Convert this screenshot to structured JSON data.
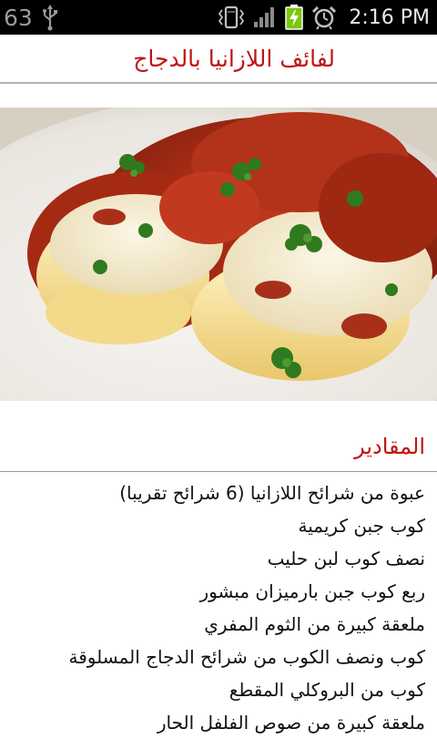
{
  "status_bar": {
    "battery_number": "63",
    "time": "2:16 PM",
    "icons": [
      "usb-icon",
      "vibrate-icon",
      "signal-icon",
      "battery-charging-icon",
      "alarm-icon"
    ]
  },
  "recipe": {
    "title": "لفائف اللازانيا بالدجاج",
    "image_description_icon": "recipe-photo",
    "section_heading": "المقادير",
    "ingredients": [
      "عبوة من شرائح اللازانيا (6 شرائح تقريبا)",
      "كوب جبن كريمية",
      "نصف كوب لبن حليب",
      "ربع كوب جبن بارميزان مبشور",
      "ملعقة كبيرة من الثوم المفري",
      "كوب ونصف الكوب من شرائح الدجاج المسلوقة",
      "كوب من البروكلي المقطع",
      "ملعقة كبيرة من صوص الفلفل الحار"
    ]
  },
  "colors": {
    "accent_red": "#c01414",
    "status_bar_bg": "#000000",
    "battery_green": "#7ac70c"
  }
}
